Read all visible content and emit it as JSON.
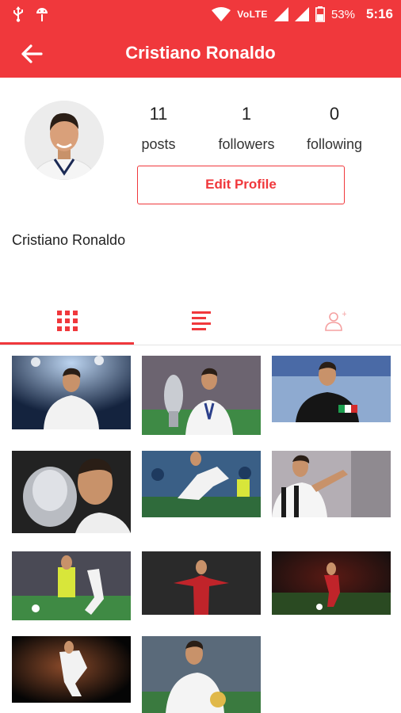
{
  "status_bar": {
    "volte": "VoLTE",
    "battery": "53%",
    "time": "5:16"
  },
  "app_bar": {
    "title": "Cristiano Ronaldo",
    "back_icon": "arrow-left-icon"
  },
  "profile": {
    "stats": [
      {
        "value": "11",
        "label": "posts"
      },
      {
        "value": "1",
        "label": "followers"
      },
      {
        "value": "0",
        "label": "following"
      }
    ],
    "edit_button": "Edit Profile",
    "display_name": "Cristiano Ronaldo"
  },
  "tabs": [
    {
      "name": "grid-view",
      "icon": "grid-icon",
      "selected": true
    },
    {
      "name": "list-view",
      "icon": "list-icon",
      "selected": false
    },
    {
      "name": "tagged-view",
      "icon": "person-tag-icon",
      "selected": false
    }
  ],
  "colors": {
    "accent": "#f0383c"
  },
  "posts_count": 11
}
